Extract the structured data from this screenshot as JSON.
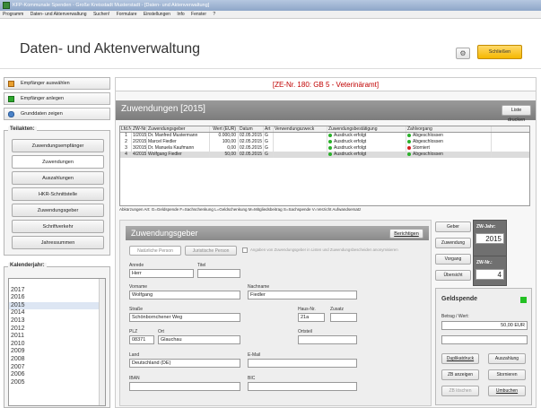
{
  "window": {
    "title": "KFP-Kommunale Spenden - Große Kreisstadt Musterstadt - [Daten- und Aktenverwaltung]"
  },
  "menu": [
    "Programm",
    "Daten- und Aktenverwaltung",
    "Suchen!",
    "Formulare",
    "Einstellungen",
    "Info",
    "Fenster",
    "?"
  ],
  "header": {
    "title": "Daten- und Aktenverwaltung",
    "close_label": "Schließen",
    "gear": "gear-icon"
  },
  "sidebar": {
    "top_buttons": [
      "Empfänger auswählen",
      "Empfänger anlegen",
      "Grunddaten zeigen"
    ],
    "group_label": "Teilakten:",
    "group_buttons": [
      "Zuwendungsempfänger",
      "Zuwendungen",
      "Auszahlungen",
      "HKR-Schnittstelle",
      "Zuwendungsgeber",
      "Schriftverkehr",
      "Jahressummen"
    ],
    "years_label": "Kalenderjahr:",
    "years": [
      "",
      "2017",
      "2016",
      "2015",
      "2014",
      "2013",
      "2012",
      "2011",
      "2010",
      "2009",
      "2008",
      "2007",
      "2006",
      "2005"
    ]
  },
  "main": {
    "ze_label": "[ZE-Nr. 180: GB 5 - Veterinäramt]",
    "panel_title": "Zuwendungen  [2015]",
    "list_print": "Liste drucken",
    "columns": [
      "Lfd.Nr.",
      "ZW-Nr.",
      "Zuwendungsgeber",
      "Wert (EUR)",
      "Datum",
      "Art",
      "Verwendungszweck",
      "Zuwendungsbestätigung",
      "Zahlvorgang"
    ],
    "rows": [
      [
        "1",
        "1/2015",
        "Dr. Manfred Mustermann",
        "0.000,00",
        "02.05.2015",
        "G",
        "",
        "Ausdruck erfolgt",
        "Abgeschlossen"
      ],
      [
        "2",
        "2/2015",
        "Marcel Fiedler",
        "100,00",
        "02.05.2015",
        "G",
        "",
        "Ausdruck erfolgt",
        "Abgeschlossen"
      ],
      [
        "3",
        "3/2015",
        "Dr. Manuela Kaufmann",
        "0,00",
        "02.05.2015",
        "G",
        "",
        "Ausdruck erfolgt",
        "Storniert"
      ],
      [
        "4",
        "4/2015",
        "Wolfgang Fiedler",
        "50,00",
        "02.05.2015",
        "G",
        "",
        "Ausdruck erfolgt",
        "Abgeschlossen"
      ]
    ],
    "legend": "Abkürzungen Art:  G=Geldspende  F=Sachschenkung  L=Geldschenkung  M=Mitgliedsbeitrag  S=Sachspende  V=Verzicht Aufwandsersatz"
  },
  "giver": {
    "title": "Zuwendungsgeber",
    "edit_button": "Berichtigen",
    "natural": "Natürliche Person",
    "legal": "Juristische Person",
    "anonymous": "Angaben von Zuwendungsgeber in Listen und Zuwendungsbescheiden anonymisieren",
    "fields": {
      "anrede": {
        "label": "Anrede",
        "value": "Herr"
      },
      "titel": {
        "label": "Titel",
        "value": ""
      },
      "vorname": {
        "label": "Vorname",
        "value": "Wolfgang"
      },
      "nachname": {
        "label": "Nachname",
        "value": "Fiedler"
      },
      "strasse": {
        "label": "Straße",
        "value": "Schönbornchener Weg"
      },
      "hausnr": {
        "label": "Haus-Nr.",
        "value": "21a"
      },
      "zusatz": {
        "label": "Zusatz",
        "value": ""
      },
      "plz": {
        "label": "PLZ",
        "value": "08371"
      },
      "ort": {
        "label": "Ort",
        "value": "Glauchau"
      },
      "ortsteil": {
        "label": "Ortsteil",
        "value": ""
      },
      "land": {
        "label": "Land",
        "value": "Deutschland (DE)"
      },
      "email": {
        "label": "E-Mail",
        "value": ""
      },
      "iban": {
        "label": "IBAN",
        "value": ""
      },
      "bic": {
        "label": "BIC",
        "value": ""
      }
    }
  },
  "right": {
    "buttons": [
      "Geber",
      "Zuwendung",
      "Vorgang",
      "Übersicht"
    ],
    "zw_jahr_label": "ZW-Jahr:",
    "zw_jahr": "2015",
    "zw_nr_label": "ZW-Nr.:",
    "zw_nr": "4",
    "geldspende": "Geldspende",
    "betrag_label": "Betrag / Wert:",
    "betrag": "50,00 EUR",
    "actions": [
      "Duplikatdruck",
      "Auszahlung",
      "ZB anzeigen",
      "Stornieren",
      "ZB löschen",
      "Umbuchen"
    ]
  }
}
